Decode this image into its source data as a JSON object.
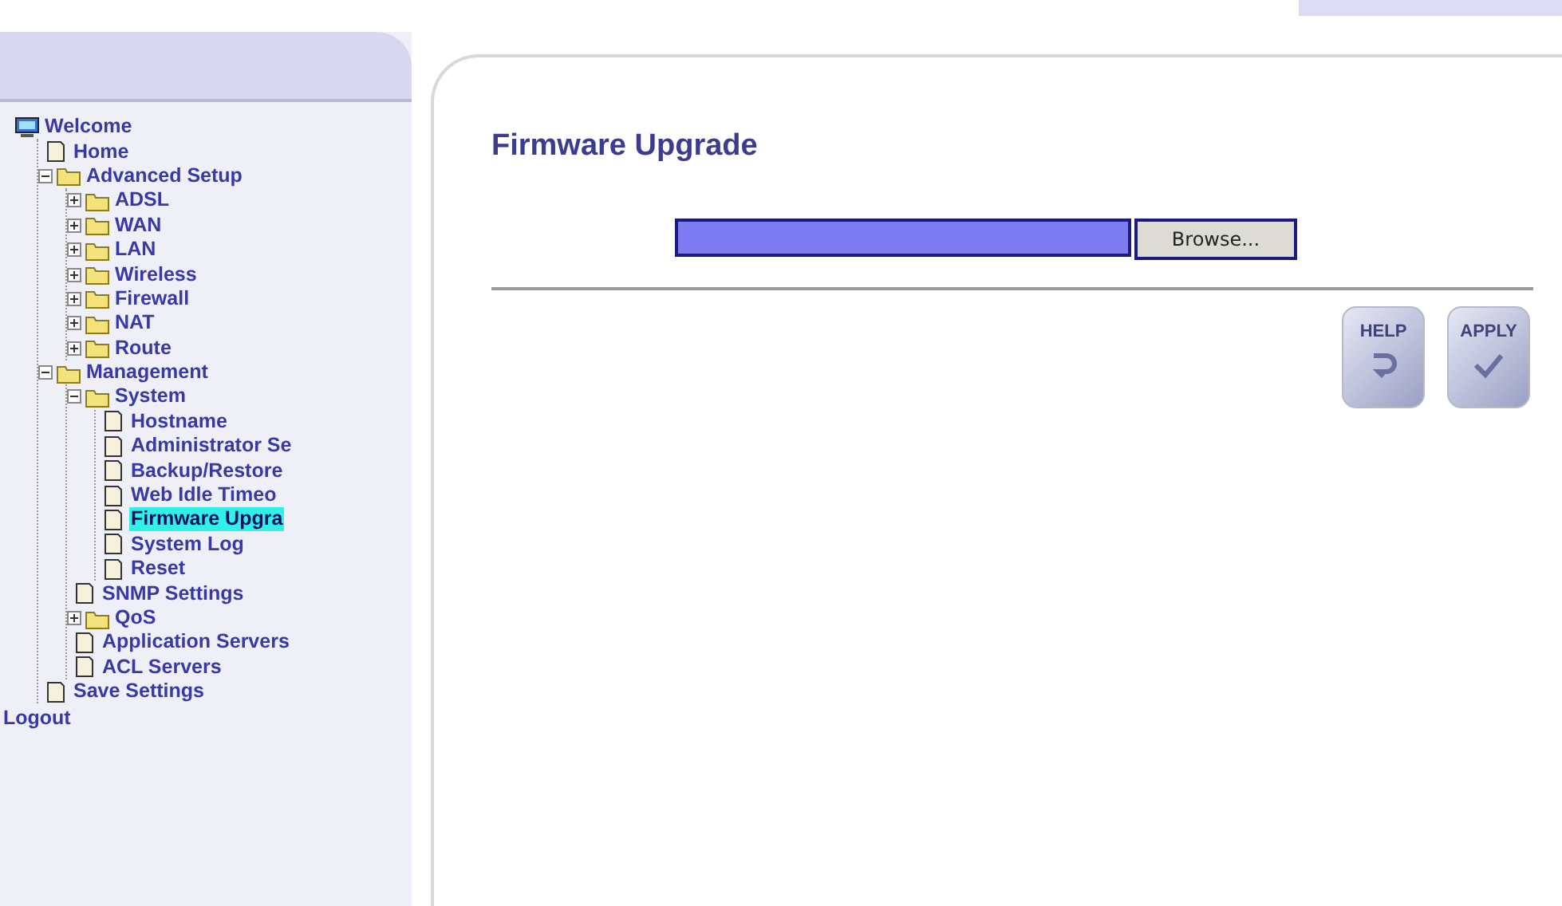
{
  "sidebar": {
    "tree": [
      {
        "label": "Welcome",
        "kind": "monitor",
        "selected": false,
        "children": [
          {
            "label": "Home",
            "kind": "page",
            "selected": false
          },
          {
            "label": "Advanced Setup",
            "kind": "folder",
            "expanded": true,
            "selected": false,
            "children": [
              {
                "label": "ADSL",
                "kind": "folder",
                "expanded": false,
                "selected": false
              },
              {
                "label": "WAN",
                "kind": "folder",
                "expanded": false,
                "selected": false
              },
              {
                "label": "LAN",
                "kind": "folder",
                "expanded": false,
                "selected": false
              },
              {
                "label": "Wireless",
                "kind": "folder",
                "expanded": false,
                "selected": false
              },
              {
                "label": "Firewall",
                "kind": "folder",
                "expanded": false,
                "selected": false
              },
              {
                "label": "NAT",
                "kind": "folder",
                "expanded": false,
                "selected": false
              },
              {
                "label": "Route",
                "kind": "folder",
                "expanded": false,
                "selected": false
              }
            ]
          },
          {
            "label": "Management",
            "kind": "folder",
            "expanded": true,
            "selected": false,
            "children": [
              {
                "label": "System",
                "kind": "folder",
                "expanded": true,
                "selected": false,
                "children": [
                  {
                    "label": "Hostname",
                    "kind": "page",
                    "selected": false
                  },
                  {
                    "label": "Administrator Se",
                    "kind": "page",
                    "selected": false
                  },
                  {
                    "label": "Backup/Restore",
                    "kind": "page",
                    "selected": false
                  },
                  {
                    "label": "Web Idle Timeo",
                    "kind": "page",
                    "selected": false
                  },
                  {
                    "label": "Firmware Upgra",
                    "kind": "page",
                    "selected": true
                  },
                  {
                    "label": "System Log",
                    "kind": "page",
                    "selected": false
                  },
                  {
                    "label": "Reset",
                    "kind": "page",
                    "selected": false
                  }
                ]
              },
              {
                "label": "SNMP Settings",
                "kind": "page",
                "selected": false
              },
              {
                "label": "QoS",
                "kind": "folder",
                "expanded": false,
                "selected": false
              },
              {
                "label": "Application Servers",
                "kind": "page",
                "selected": false
              },
              {
                "label": "ACL Servers",
                "kind": "page",
                "selected": false
              }
            ]
          },
          {
            "label": "Save Settings",
            "kind": "page",
            "selected": false
          }
        ]
      }
    ],
    "logout": "Logout"
  },
  "main": {
    "title": "Firmware Upgrade",
    "browse_button": "Browse...",
    "buttons": [
      {
        "label": "HELP",
        "kind": "help"
      },
      {
        "label": "APPLY",
        "kind": "apply"
      }
    ]
  }
}
